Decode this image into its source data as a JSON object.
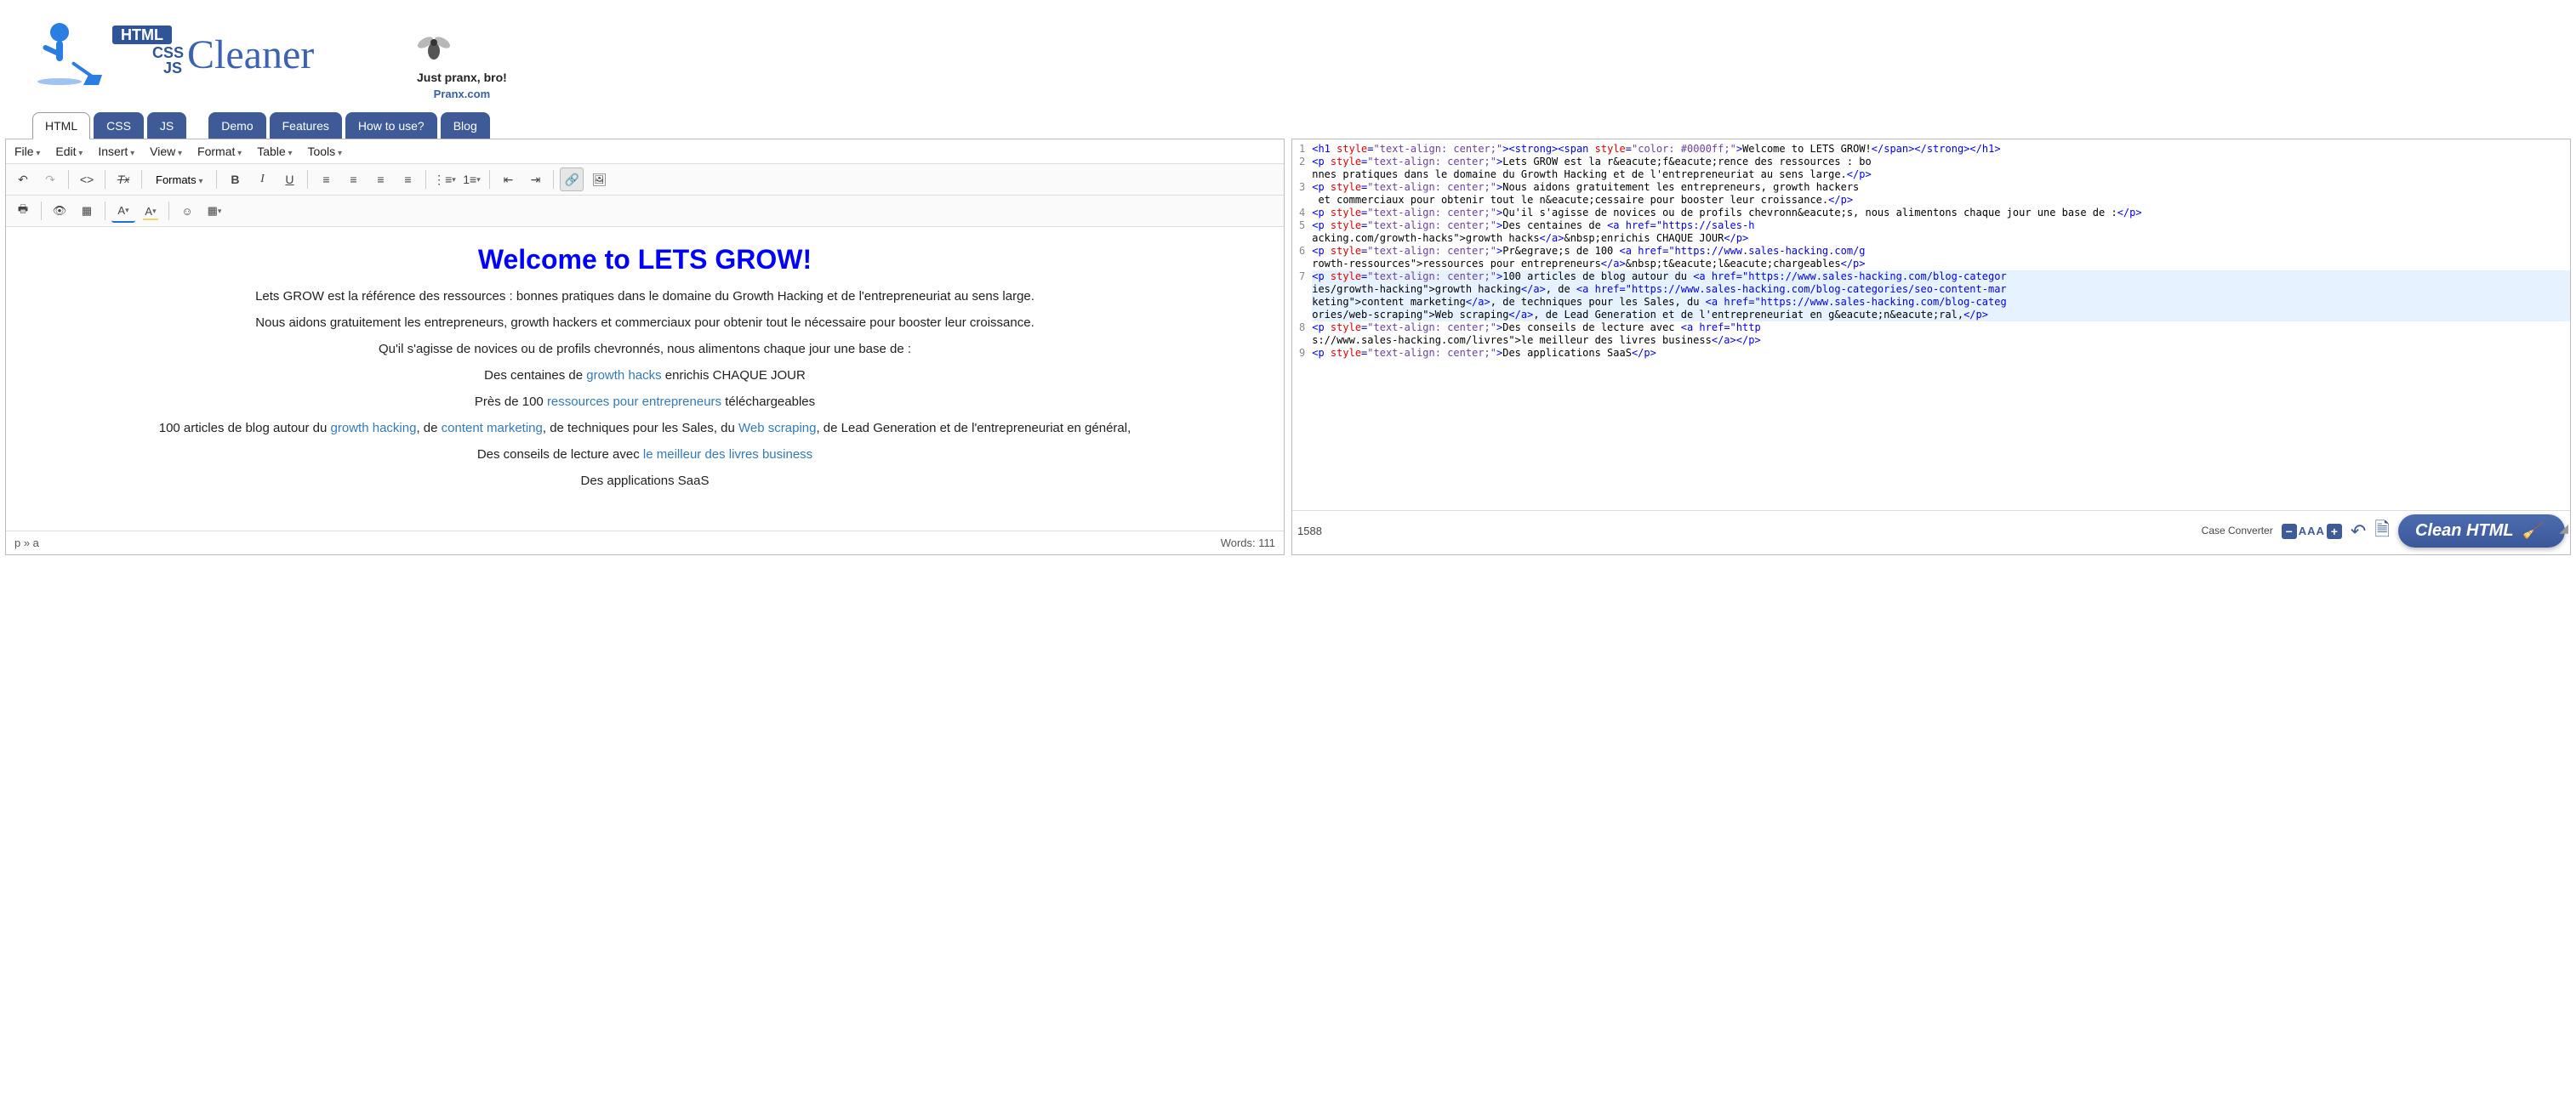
{
  "logo": {
    "brand": "Cleaner",
    "html": "HTML",
    "css": "CSS",
    "js": "JS"
  },
  "ad": {
    "line1": "Just pranx, bro!",
    "line2": "Pranx.com"
  },
  "tabs": [
    "HTML",
    "CSS",
    "JS",
    "Demo",
    "Features",
    "How to use?",
    "Blog"
  ],
  "active_tab_index": 0,
  "menubar": [
    "File",
    "Edit",
    "Insert",
    "View",
    "Format",
    "Table",
    "Tools"
  ],
  "toolbar": {
    "formats_label": "Formats"
  },
  "editor": {
    "h1": "Welcome to LETS GROW!",
    "paragraphs": [
      "Lets GROW est la référence des ressources : bonnes pratiques dans le domaine du Growth Hacking et de l'entrepreneuriat au sens large.",
      "Nous aidons gratuitement les entrepreneurs, growth hackers et commerciaux pour obtenir tout le nécessaire pour booster leur croissance.",
      "Qu'il s'agisse de novices ou de profils chevronnés, nous alimentons chaque jour une base de :"
    ],
    "p4_pre": "Des centaines de ",
    "p4_link": "growth hacks",
    "p4_post": " enrichis CHAQUE JOUR",
    "p5_pre": "Près de 100 ",
    "p5_link": "ressources pour entrepreneurs",
    "p5_post": " téléchargeables",
    "p6_pre": "100 articles de blog autour du ",
    "p6_l1": "growth hacking",
    "p6_m1": ", de ",
    "p6_l2": "content marketing",
    "p6_m2": ", de techniques pour les Sales, du ",
    "p6_l3": "Web scraping",
    "p6_m3": ", de Lead Generation et de l'entrepreneuriat en général,",
    "p7_pre": "Des conseils de lecture avec ",
    "p7_link": "le meilleur des livres business",
    "p8": "Des applications SaaS"
  },
  "status": {
    "path": "p » a",
    "words_label": "Words: 111"
  },
  "code": {
    "line_numbers": [
      "1",
      "2",
      "",
      "3",
      "",
      "4",
      "5",
      "",
      "6",
      "",
      "7",
      "",
      "",
      "",
      "8",
      "",
      "9"
    ],
    "highlight_rows": [
      10,
      11,
      12,
      13
    ]
  },
  "source_raw": {
    "l1": "<h1 style=\"text-align: center;\"><strong><span style=\"color: #0000ff;\">Welcome to LETS GROW!</span></strong></h1>",
    "l2": "<p style=\"text-align: center;\">Lets GROW est la r&eacute;f&eacute;rence des ressources : bonnes pratiques dans le domaine du Growth Hacking et de l'entrepreneuriat au sens large.</p>",
    "l3": "<p style=\"text-align: center;\">Nous aidons gratuitement les entrepreneurs, growth hackers et commerciaux pour obtenir tout le n&eacute;cessaire pour booster leur croissance.</p>",
    "l4": "<p style=\"text-align: center;\">Qu'il s'agisse de novices ou de profils chevronn&eacute;s, nous alimentons chaque jour une base de :</p>",
    "l5": "<p style=\"text-align: center;\">Des centaines de <a href=\"https://sales-hacking.com/growth-hacks\">growth hacks</a>&nbsp;enrichis CHAQUE JOUR</p>",
    "l6": "<p style=\"text-align: center;\">Pr&egrave;s de 100 <a href=\"https://www.sales-hacking.com/growth-ressources\">ressources pour entrepreneurs</a>&nbsp;t&eacute;l&eacute;chargeables</p>",
    "l7": "<p style=\"text-align: center;\">100 articles de blog autour du <a href=\"https://www.sales-hacking.com/blog-categories/growth-hacking\">growth hacking</a>, de <a href=\"https://www.sales-hacking.com/blog-categories/seo-content-marketing\">content marketing</a>, de techniques pour les Sales, du <a href=\"https://www.sales-hacking.com/blog-categories/web-scraping\">Web scraping</a>, de Lead Generation et de l'entrepreneuriat en g&eacute;n&eacute;ral,</p>",
    "l8": "<p style=\"text-align: center;\">Des conseils de lecture avec <a href=\"https://www.sales-hacking.com/livres\">le meilleur des livres business</a></p>",
    "l9": "<p style=\"text-align: center;\">Des applications SaaS</p>"
  },
  "bottom": {
    "char_count": "1588",
    "case_converter": "Case Converter",
    "font_mid": "AAA",
    "clean_btn": "Clean HTML"
  }
}
